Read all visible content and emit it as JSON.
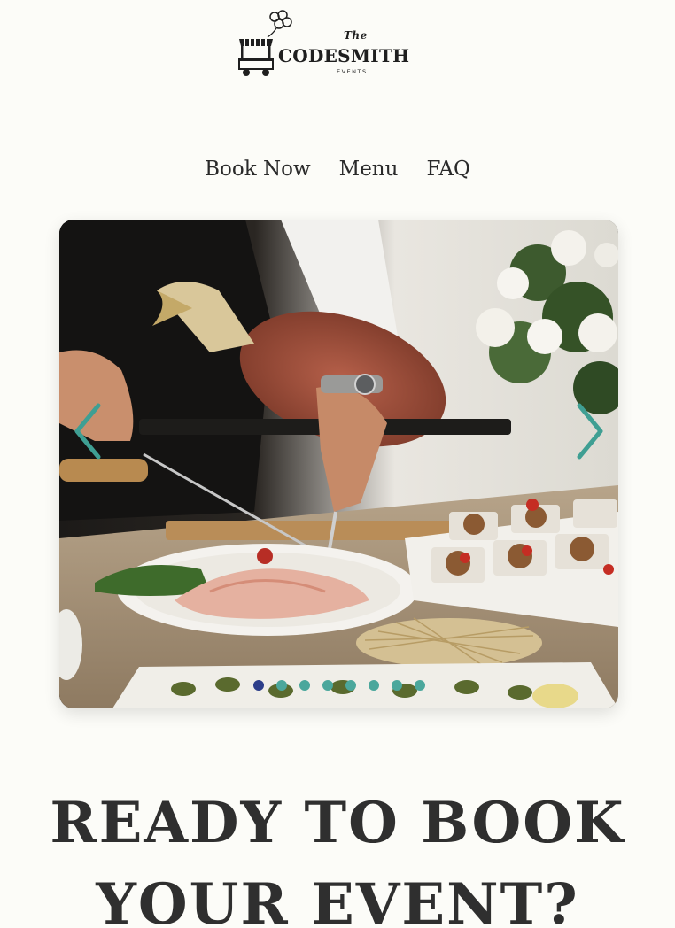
{
  "logo": {
    "the": "The",
    "name": "CODESMITH",
    "sub": "EVENTS",
    "icon": "food-cart-balloons-icon"
  },
  "nav": {
    "items": [
      {
        "label": "Book Now"
      },
      {
        "label": "Menu"
      },
      {
        "label": "FAQ"
      }
    ]
  },
  "hero": {
    "image": "catering-spread-photo",
    "prev_icon": "chevron-left-icon",
    "next_icon": "chevron-right-icon",
    "slide_count": 8,
    "active_slide": 1,
    "colors": {
      "arrow": "#3f9f93",
      "dot": "#4ba79c",
      "dot_active": "#2d3e8a"
    }
  },
  "headline": {
    "line1": "READY TO BOOK",
    "line2": "YOUR EVENT?"
  }
}
